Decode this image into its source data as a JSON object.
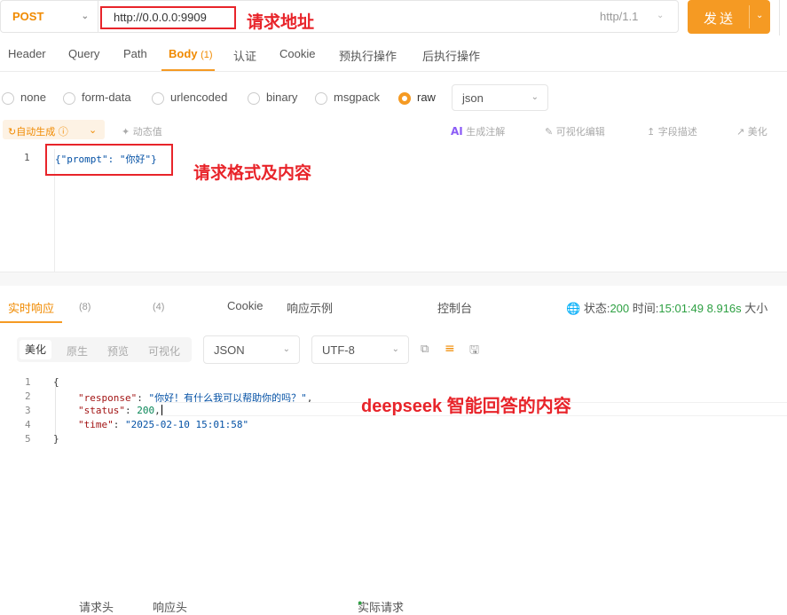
{
  "request": {
    "method": "POST",
    "url": "http://0.0.0.0:9909",
    "protocol": "http/1.1",
    "send_label": "发送"
  },
  "annotations": {
    "url_label": "请求地址",
    "body_label": "请求格式及内容",
    "response_label": "deepseek 智能回答的内容"
  },
  "request_tabs": [
    {
      "label": "Header"
    },
    {
      "label": "Query"
    },
    {
      "label": "Path"
    },
    {
      "label": "Body",
      "count": "(1)"
    },
    {
      "label": "认证"
    },
    {
      "label": "Cookie"
    },
    {
      "label": "预执行操作"
    },
    {
      "label": "后执行操作"
    }
  ],
  "body_types": [
    "none",
    "form-data",
    "urlencoded",
    "binary",
    "msgpack",
    "raw"
  ],
  "body_selected": "raw",
  "body_format": "json",
  "body_toolbar": {
    "auto_generate": "自动生成",
    "dynamic_value": "动态值",
    "ai_badge": "AI",
    "generate_comments": "生成注解",
    "visual_edit": "可视化编辑",
    "field_desc": "字段描述",
    "beautify": "美化"
  },
  "request_body": {
    "line_number": "1",
    "code": "{\"prompt\": \"你好\"}"
  },
  "response_tabs": [
    {
      "label": "实时响应"
    },
    {
      "label": "请求头",
      "count": "(8)"
    },
    {
      "label": "响应头",
      "count": "(4)"
    },
    {
      "label": "Cookie"
    },
    {
      "label": "响应示例"
    },
    {
      "label": "实际请求"
    },
    {
      "label": "控制台"
    }
  ],
  "status_bar": {
    "status_label": "状态:",
    "status_value": "200",
    "time_label": "时间:",
    "time_value": "15:01:49",
    "duration": "8.916s",
    "size_label": "大小"
  },
  "view_modes": [
    "美化",
    "原生",
    "预览",
    "可视化"
  ],
  "response_format": "JSON",
  "response_encoding": "UTF-8",
  "response_lines": [
    {
      "n": "1",
      "text": "{"
    },
    {
      "n": "2",
      "key": "\"response\"",
      "value": "\"你好！有什么我可以帮助你的吗？\"",
      "suffix": ","
    },
    {
      "n": "3",
      "key": "\"status\"",
      "value": "200",
      "suffix": ","
    },
    {
      "n": "4",
      "key": "\"time\"",
      "value": "\"2025-02-10 15:01:58\"",
      "suffix": ""
    },
    {
      "n": "5",
      "text": "}"
    }
  ],
  "colors": {
    "accent": "#f59a23",
    "annotation": "#e8242a",
    "success": "#2ea043"
  }
}
